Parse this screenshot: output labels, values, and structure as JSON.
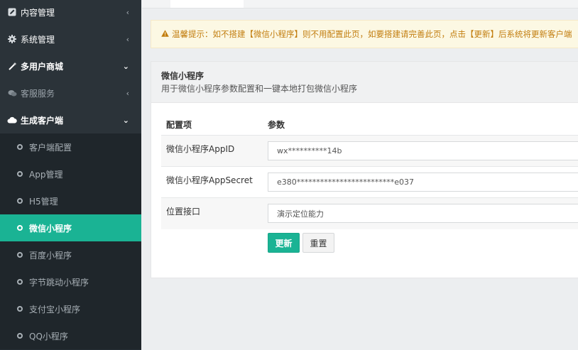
{
  "sidebar": {
    "items": [
      {
        "label": "内容管理",
        "icon": "edit-icon",
        "chevron": "‹"
      },
      {
        "label": "系统管理",
        "icon": "gear-icon",
        "chevron": "‹"
      },
      {
        "label": "多用户商城",
        "icon": "magic-wand-icon",
        "chevron": "⌄"
      },
      {
        "label": "客服服务",
        "icon": "chat-icon",
        "chevron": "‹"
      },
      {
        "label": "生成客户端",
        "icon": "cloud-icon",
        "chevron": "⌄"
      }
    ],
    "subitems": [
      {
        "label": "客户端配置"
      },
      {
        "label": "App管理"
      },
      {
        "label": "H5管理"
      },
      {
        "label": "微信小程序",
        "active": true
      },
      {
        "label": "百度小程序"
      },
      {
        "label": "字节跳动小程序"
      },
      {
        "label": "支付宝小程序"
      },
      {
        "label": "QQ小程序"
      }
    ]
  },
  "alert": {
    "icon": "warning-icon",
    "text": "温馨提示：如不搭建【微信小程序】则不用配置此页，如要搭建请完善此页，点击【更新】后系统将更新客户端"
  },
  "panel": {
    "title": "微信小程序",
    "subtitle": "用于微信小程序参数配置和一键本地打包微信小程序"
  },
  "table": {
    "headers": [
      "配置项",
      "参数"
    ],
    "rows": [
      {
        "label": "微信小程序AppID",
        "value": "wx**********14b"
      },
      {
        "label": "微信小程序AppSecret",
        "value": "e380*************************e037"
      },
      {
        "label": "位置接口",
        "value": "演示定位能力"
      }
    ]
  },
  "buttons": {
    "update": "更新",
    "reset": "重置"
  },
  "colors": {
    "accent": "#1ab394",
    "sidebar_bg": "#252d33",
    "alert_bg": "#fcf8e3",
    "alert_text": "#c27d0e"
  }
}
